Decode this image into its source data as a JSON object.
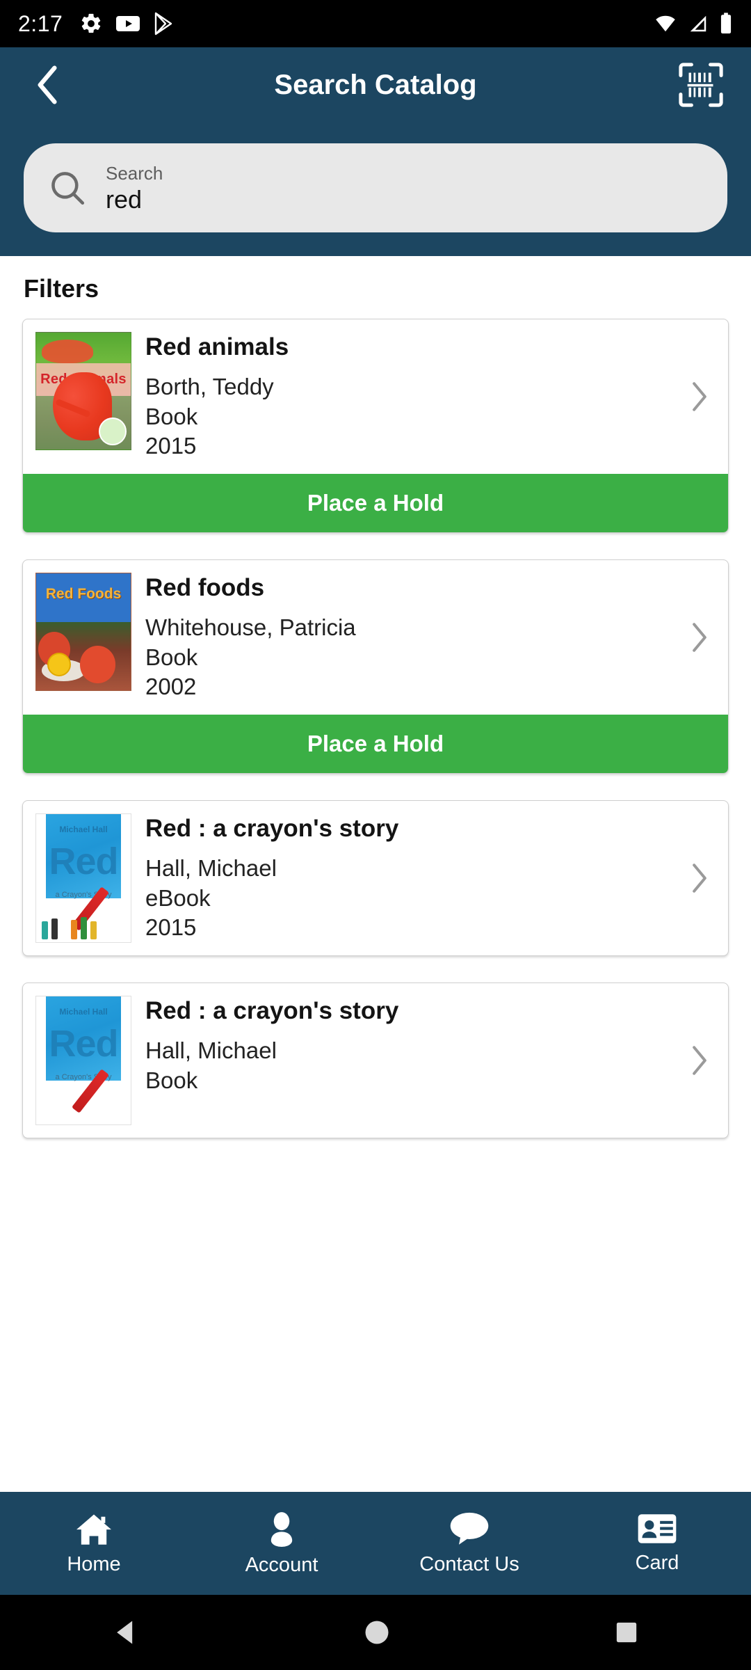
{
  "status_bar": {
    "time": "2:17",
    "left_icons": [
      "settings-gear-icon",
      "youtube-icon",
      "app-icon"
    ],
    "right_icons": [
      "wifi-icon",
      "cellular-signal-icon",
      "battery-icon"
    ]
  },
  "app_bar": {
    "back_icon": "chevron-left-icon",
    "title": "Search Catalog",
    "scan_icon": "barcode-scanner-icon",
    "background_color": "#1C4661"
  },
  "search": {
    "icon": "search-icon",
    "label": "Search",
    "value": "red",
    "placeholder": "Search"
  },
  "filters": {
    "title": "Filters"
  },
  "results": [
    {
      "title": "Red animals",
      "author": "Borth, Teddy",
      "format": "Book",
      "year": "2015",
      "cover_title": "Red Animals",
      "cover_style": "animals",
      "chevron_icon": "chevron-right-icon",
      "action_label": "Place a Hold",
      "has_action": true
    },
    {
      "title": "Red foods",
      "author": "Whitehouse, Patricia",
      "format": "Book",
      "year": "2002",
      "cover_title": "Red Foods",
      "cover_style": "foods",
      "chevron_icon": "chevron-right-icon",
      "action_label": "Place a Hold",
      "has_action": true
    },
    {
      "title": "Red : a crayon's story",
      "author": "Hall, Michael",
      "format": "eBook",
      "year": "2015",
      "cover_title": "Red",
      "cover_author": "Michael Hall",
      "cover_subtitle": "a Crayon's Story",
      "cover_style": "red",
      "chevron_icon": "chevron-right-icon",
      "action_label": "",
      "has_action": false
    },
    {
      "title": "Red : a crayon's story",
      "author": "Hall, Michael",
      "format": "Book",
      "year": "",
      "cover_title": "Red",
      "cover_author": "Michael Hall",
      "cover_subtitle": "a Crayon's Story",
      "cover_style": "red",
      "chevron_icon": "chevron-right-icon",
      "action_label": "",
      "has_action": false
    }
  ],
  "bottom_nav": {
    "items": [
      {
        "label": "Home",
        "icon": "home-icon"
      },
      {
        "label": "Account",
        "icon": "person-icon"
      },
      {
        "label": "Contact Us",
        "icon": "speech-bubble-icon"
      },
      {
        "label": "Card",
        "icon": "id-card-icon"
      }
    ]
  },
  "system_nav": {
    "back_icon": "triangle-back-icon",
    "home_icon": "circle-home-icon",
    "recents_icon": "square-recents-icon"
  },
  "colors": {
    "header": "#1C4661",
    "action_green": "#3BAF45",
    "search_field": "#E8E8E8"
  }
}
